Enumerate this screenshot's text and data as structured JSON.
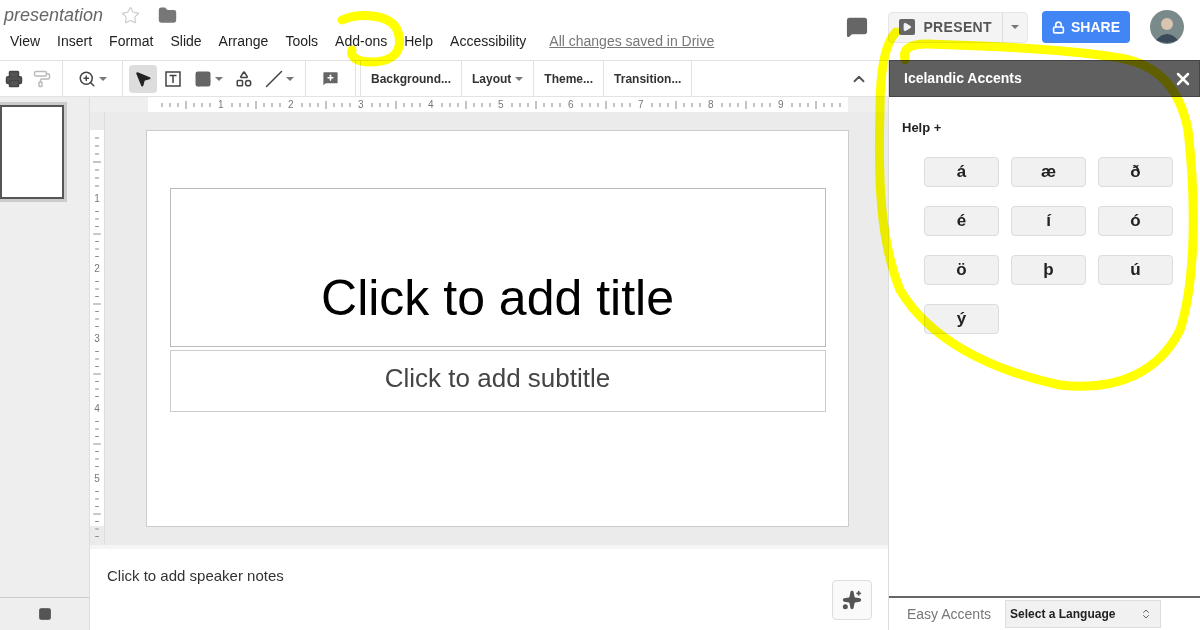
{
  "document": {
    "title": "presentation",
    "starred": false
  },
  "menu": [
    "View",
    "Insert",
    "Format",
    "Slide",
    "Arrange",
    "Tools",
    "Add-ons",
    "Help",
    "Accessibility"
  ],
  "save_status": "All changes saved in Drive",
  "header_buttons": {
    "present": "PRESENT",
    "share": "SHARE"
  },
  "toolbar": {
    "text_buttons": [
      {
        "label": "Background...",
        "dropdown": false
      },
      {
        "label": "Layout",
        "dropdown": true
      },
      {
        "label": "Theme...",
        "dropdown": false
      },
      {
        "label": "Transition...",
        "dropdown": false
      }
    ]
  },
  "ruler": {
    "horizontal": [
      "1",
      "2",
      "3",
      "4",
      "5",
      "6",
      "7",
      "8",
      "9"
    ],
    "vertical": [
      "1",
      "2",
      "3",
      "4",
      "5"
    ]
  },
  "slides": [
    {
      "selected": true
    }
  ],
  "slide": {
    "title_placeholder": "Click to add title",
    "subtitle_placeholder": "Click to add subtitle"
  },
  "notes": {
    "placeholder": "Click to add speaker notes"
  },
  "sidebar": {
    "title": "Icelandic Accents",
    "help": "Help +",
    "accents": [
      "á",
      "æ",
      "ð",
      "é",
      "í",
      "ó",
      "ö",
      "þ",
      "ú",
      "ý"
    ],
    "footer_label": "Easy Accents",
    "language_select": {
      "placeholder": "Select a Language"
    }
  }
}
